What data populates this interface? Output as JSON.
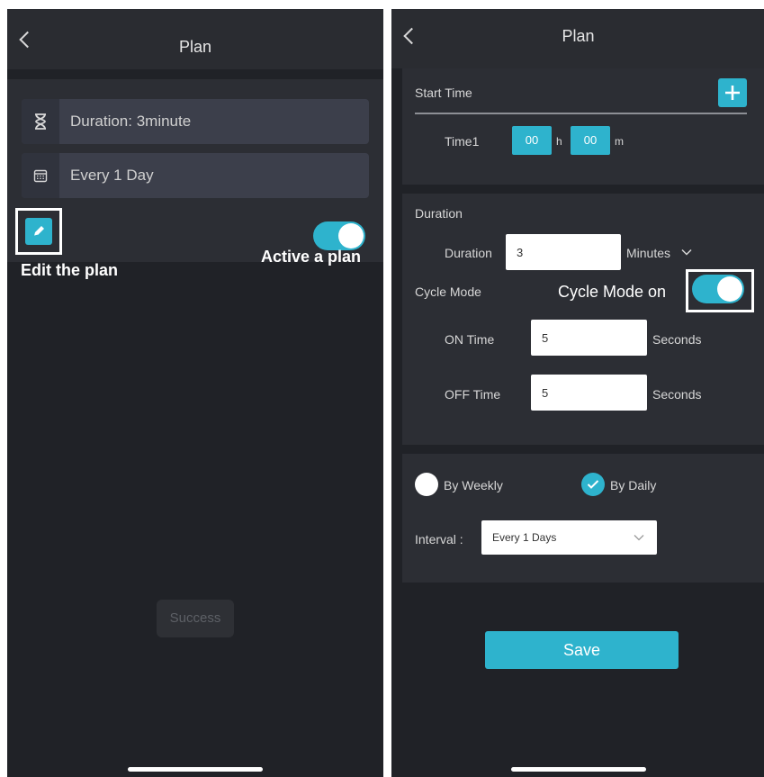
{
  "left": {
    "title": "Plan",
    "duration_text": "Duration: 3minute",
    "repeat_text": "Every 1 Day",
    "toast": "Success",
    "annotations": {
      "edit": "Edit the plan",
      "active": "Active a plan"
    }
  },
  "right": {
    "title": "Plan",
    "start_time": {
      "label": "Start Time",
      "time1_label": "Time1",
      "hour": "00",
      "hour_unit": "h",
      "minute": "00",
      "minute_unit": "m"
    },
    "duration": {
      "section_label": "Duration",
      "field_label": "Duration",
      "value": "3",
      "unit": "Minutes",
      "cycle_mode_label": "Cycle Mode",
      "cycle_annotation": "Cycle Mode on",
      "on_time_label": "ON Time",
      "on_time_value": "5",
      "off_time_label": "OFF Time",
      "off_time_value": "5",
      "seconds_label": "Seconds"
    },
    "schedule": {
      "weekly_label": "By Weekly",
      "daily_label": "By Daily",
      "interval_label": "Interval :",
      "interval_value": "Every 1 Days"
    },
    "save_label": "Save"
  },
  "colors": {
    "accent": "#2eb3cd",
    "background": "#202227",
    "card": "#2c2e34"
  },
  "icons": [
    "back-arrow-icon",
    "hourglass-icon",
    "calendar-icon",
    "pencil-icon",
    "plus-icon",
    "chevron-down-icon",
    "check-icon"
  ]
}
